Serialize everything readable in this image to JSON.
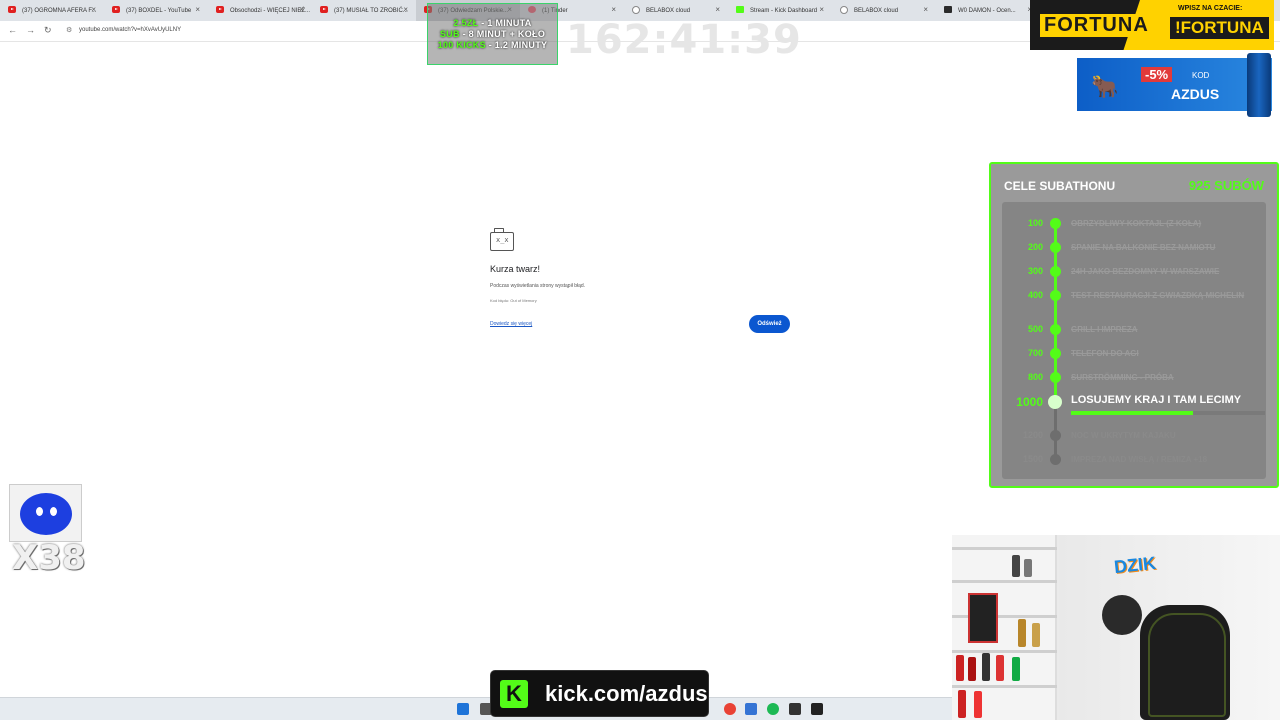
{
  "browser": {
    "tabs": [
      {
        "label": "(37) OGROMNA AFERA F...",
        "icon": "youtube-icon",
        "active": false
      },
      {
        "label": "(37) BOXDEL - YouTube",
        "icon": "youtube-icon",
        "active": false
      },
      {
        "label": "Obsochodzi - WIĘCEJ NIEŻ...",
        "icon": "youtube-icon",
        "active": false
      },
      {
        "label": "(37) MUSIAŁ TO ZROBIĆ...",
        "icon": "youtube-icon",
        "active": false
      },
      {
        "label": "(37) Odwiedzam Polskie...",
        "icon": "youtube-icon",
        "active": true
      },
      {
        "label": "(1) Tinder",
        "icon": "tinder-icon",
        "active": false
      },
      {
        "label": "BELABOX cloud",
        "icon": "globe-icon",
        "active": false
      },
      {
        "label": "Stream - Kick Dashboard",
        "icon": "kick-icon",
        "active": false
      },
      {
        "label": "BELABOX cloud",
        "icon": "globe-icon",
        "active": false
      },
      {
        "label": "W0 DAMON - Ocen...",
        "icon": "w-icon",
        "active": false
      }
    ],
    "url": "youtube.com/watch?v=hXvAvUyULNY"
  },
  "error_page": {
    "title": "Kurza twarz!",
    "description": "Podczas wyświetlania strony wystąpił błąd.",
    "code": "Kod błędu: Out of Memory",
    "learn_more": "Dowiedz się więcej",
    "reload": "Odśwież"
  },
  "overlay": {
    "rules": [
      {
        "accent": "2.5ZŁ",
        "text": " - 1 MINUTA"
      },
      {
        "accent": "SUB",
        "text": " - 8 MINUT + KOŁO"
      },
      {
        "accent": "100 KICKS",
        "text": " - 1.2 MINUTY"
      }
    ],
    "timer": "162:41:39",
    "fortuna": {
      "brand": "FORTUNA",
      "prompt": "WPISZ NA CZACIE:",
      "command": "!FORTUNA"
    },
    "dzik_ad": {
      "discount": "-5%",
      "code_label": "KOD",
      "code": "AZDUS"
    },
    "alert_count": "X38",
    "kick_banner": "kick.com/azdus",
    "accent_color": "#53fc18"
  },
  "goals": {
    "title": "CELE SUBATHONU",
    "subs": "925 SUBÓW",
    "progress": 0.63,
    "items": [
      {
        "num": "100",
        "label": "OBRZYDLIWY KOKTAJL (Z KOŁA)",
        "status": "done"
      },
      {
        "num": "200",
        "label": "SPANIE NA BALKONIE BEZ NAMIOTU",
        "status": "done"
      },
      {
        "num": "300",
        "label": "24H JAKO BEZDOMNY W WARSZAWIE",
        "status": "done"
      },
      {
        "num": "400",
        "label": "TEST RESTAURACJI Z GWIAZDKĄ MICHELIN",
        "status": "done"
      },
      {
        "num": "500",
        "label": "GRILL I IMPREZA",
        "status": "done"
      },
      {
        "num": "700",
        "label": "TELEFON DO AGI",
        "status": "done"
      },
      {
        "num": "800",
        "label": "SURSTRÖMMING - PRÓBA",
        "status": "done"
      },
      {
        "num": "1000",
        "label": "LOSUJEMY KRAJ I TAM LECIMY",
        "status": "current"
      },
      {
        "num": "1200",
        "label": "NOC W UKRYTYM KAJAKU",
        "status": "future"
      },
      {
        "num": "1500",
        "label": "IMPREZA NAD WISŁĄ / REMIZA +18",
        "status": "future"
      }
    ]
  },
  "taskbar": {
    "icons": [
      "windows-start-icon",
      "search-icon",
      "chrome-icon",
      "explorer-icon",
      "spotify-icon",
      "terminal-icon",
      "obs-icon"
    ]
  },
  "webcam": {
    "logo": "DZIK"
  }
}
